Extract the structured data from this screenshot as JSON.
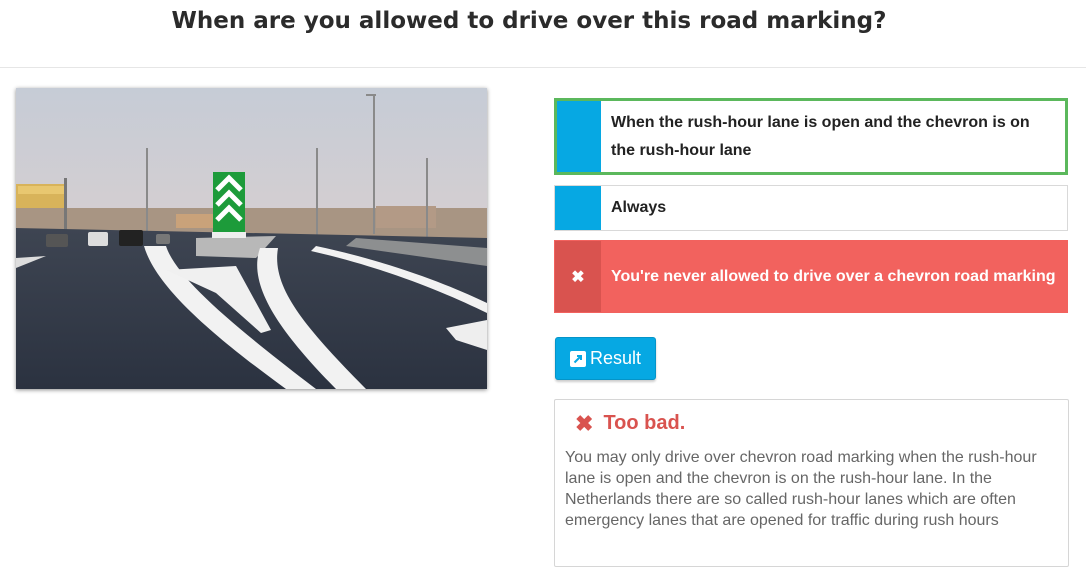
{
  "question": {
    "title": "When are you allowed to drive over this road marking?"
  },
  "image": {
    "caption": "",
    "sign_colors": {
      "chevron_green": "#1d9b3a",
      "chevron_white": "#ffffff"
    }
  },
  "answers": [
    {
      "text": "When the rush-hour lane is open and the chevron is on the rush-hour lane",
      "state": "correct",
      "marker": ""
    },
    {
      "text": "Always",
      "state": "neutral",
      "marker": ""
    },
    {
      "text": "You're never allowed to drive over a chevron road marking",
      "state": "wrong",
      "marker": "✖"
    }
  ],
  "result_button": {
    "label": "Result",
    "icon": "external-link-icon"
  },
  "feedback": {
    "icon": "✖",
    "title": "Too bad.",
    "body": "You may only drive over chevron road marking when the rush-hour lane is open and the chevron is on the rush-hour lane. In the Netherlands there are so called rush-hour lanes which are often emergency lanes that are opened for traffic during rush hours"
  },
  "colors": {
    "accent": "#06a8e3",
    "correct": "#5bb85c",
    "wrong": "#f2625e",
    "wrong_dark": "#d9534f"
  }
}
